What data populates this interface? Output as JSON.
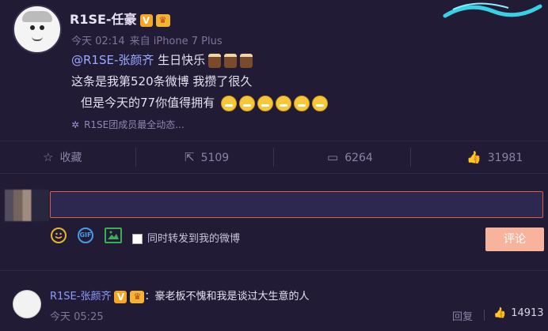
{
  "post": {
    "username": "R1SE-任豪",
    "verified_badge": "V",
    "time": "今天 02:14",
    "source": "来自 iPhone 7 Plus",
    "mention": "@R1SE-张颜齐",
    "line1_text": "生日快乐",
    "line2": "这条是我第520条微博 我攒了很久",
    "line3": "但是今天的77你值得拥有",
    "topic": "R1SE团成员最全动态..."
  },
  "actions": {
    "favorite_label": "收藏",
    "repost_count": "5109",
    "comment_count": "6264",
    "like_count": "31981"
  },
  "composer": {
    "input_value": "",
    "forward_label": "同时转发到我的微博",
    "submit_label": "评论",
    "gif_label": "GIF"
  },
  "comment": {
    "username": "R1SE-张颜齐",
    "verified_badge": "V",
    "colon": "：",
    "text": "豪老板不愧和我是谈过大生意的人",
    "time": "今天 05:25",
    "reply_label": "回复",
    "like_count": "14913"
  },
  "colors": {
    "background": "#221b36",
    "accent_link": "#9aa9ff",
    "input_border": "#d35f4a",
    "submit_bg": "#f7b39b"
  }
}
